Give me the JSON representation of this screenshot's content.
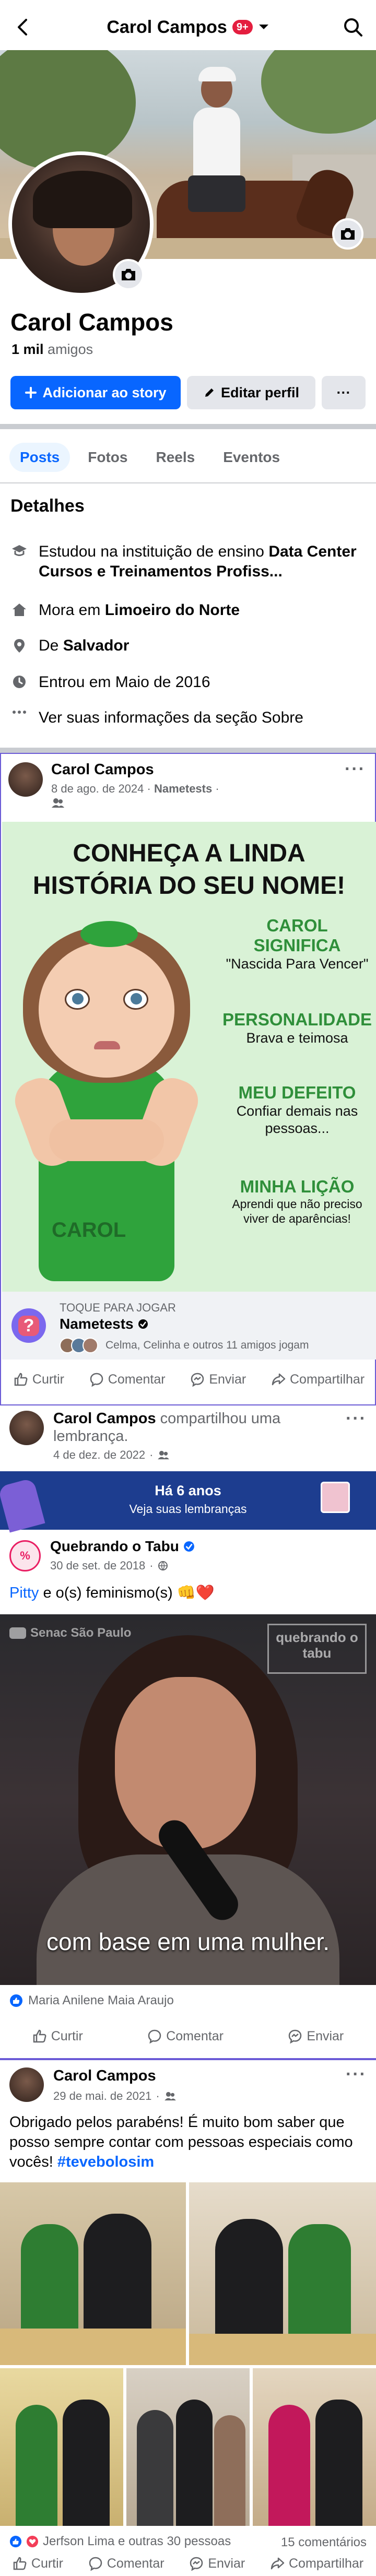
{
  "header": {
    "title": "Carol Campos",
    "badge": "9+"
  },
  "profile": {
    "name": "Carol Campos",
    "friends_count": "1 mil",
    "friends_label": "amigos",
    "add_story_label": "Adicionar ao story",
    "edit_profile_label": "Editar perfil",
    "more_label": "···"
  },
  "tabs": [
    {
      "label": "Posts"
    },
    {
      "label": "Fotos"
    },
    {
      "label": "Reels"
    },
    {
      "label": "Eventos"
    }
  ],
  "details": {
    "title": "Detalhes",
    "education_prefix": "Estudou na instituição de ensino ",
    "education_place": "Data Center Cursos e Treinamentos Profiss...",
    "lives_prefix": "Mora em ",
    "lives_city": "Limoeiro do Norte",
    "from_prefix": "De ",
    "from_city": "Salvador",
    "joined": "Entrou em Maio de 2016",
    "about_link": "Ver suas informações da seção Sobre"
  },
  "post1": {
    "author": "Carol Campos",
    "date": "8 de ago. de 2024",
    "app": "Nametests",
    "game": {
      "title_line1": "CONHEÇA A LINDA",
      "title_line2": "HISTÓRIA DO SEU NOME!",
      "sections": [
        {
          "heading": "CAROL SIGNIFICA",
          "text": "\"Nascida Para Vencer\""
        },
        {
          "heading": "PERSONALIDADE",
          "text": "Brava e teimosa"
        },
        {
          "heading": "MEU DEFEITO",
          "text": "Confiar demais nas pessoas..."
        },
        {
          "heading": "MINHA LIÇÃO",
          "text": "Aprendi que não preciso viver de aparências!"
        }
      ],
      "name_tag": "CAROL"
    },
    "play_hint": "TOQUE PARA JOGAR",
    "play_app": "Nametests",
    "players": "Celma, Celinha e outros 11 amigos jogam"
  },
  "actions": {
    "like": "Curtir",
    "comment": "Comentar",
    "send": "Enviar",
    "share": "Compartilhar"
  },
  "post2": {
    "author": "Carol Campos",
    "action_text": "compartilhou uma lembrança.",
    "date": "4 de dez. de 2022",
    "memory_title": "Há 6 anos",
    "memory_link": "Veja suas lembranças",
    "shared_page": "Quebrando o Tabu",
    "shared_date": "30 de set. de 2018",
    "shared_text_link": "Pitty",
    "shared_text": " e o(s) feminismo(s) 👊❤️",
    "video_watermark": "Senac São Paulo",
    "video_logo": "quebrando o tabu",
    "video_caption": "com base em uma mulher.",
    "likes": "Maria Anilene Maia Araujo"
  },
  "post3": {
    "author": "Carol Campos",
    "date": "29 de mai. de 2021",
    "text": "Obrigado pelos parabéns! É muito bom saber que posso sempre contar com pessoas especiais como vocês! ",
    "hashtag": "#tevebolosim",
    "reactions": "Jerfson Lima e outras 30 pessoas",
    "comments": "15 comentários"
  },
  "colors": {
    "primary": "#0866ff",
    "badge": "#e41e3f",
    "game_green": "#2f8f3a",
    "post_border": "#6b5bd6"
  },
  "icons": [
    "back-arrow-icon",
    "chevron-down-icon",
    "search-icon",
    "camera-icon",
    "plus-icon",
    "pencil-icon",
    "graduation-cap-icon",
    "home-icon",
    "location-pin-icon",
    "clock-icon",
    "ellipsis-icon",
    "friends-privacy-icon",
    "like-icon",
    "comment-icon",
    "send-icon",
    "share-icon",
    "globe-icon",
    "verified-icon"
  ]
}
